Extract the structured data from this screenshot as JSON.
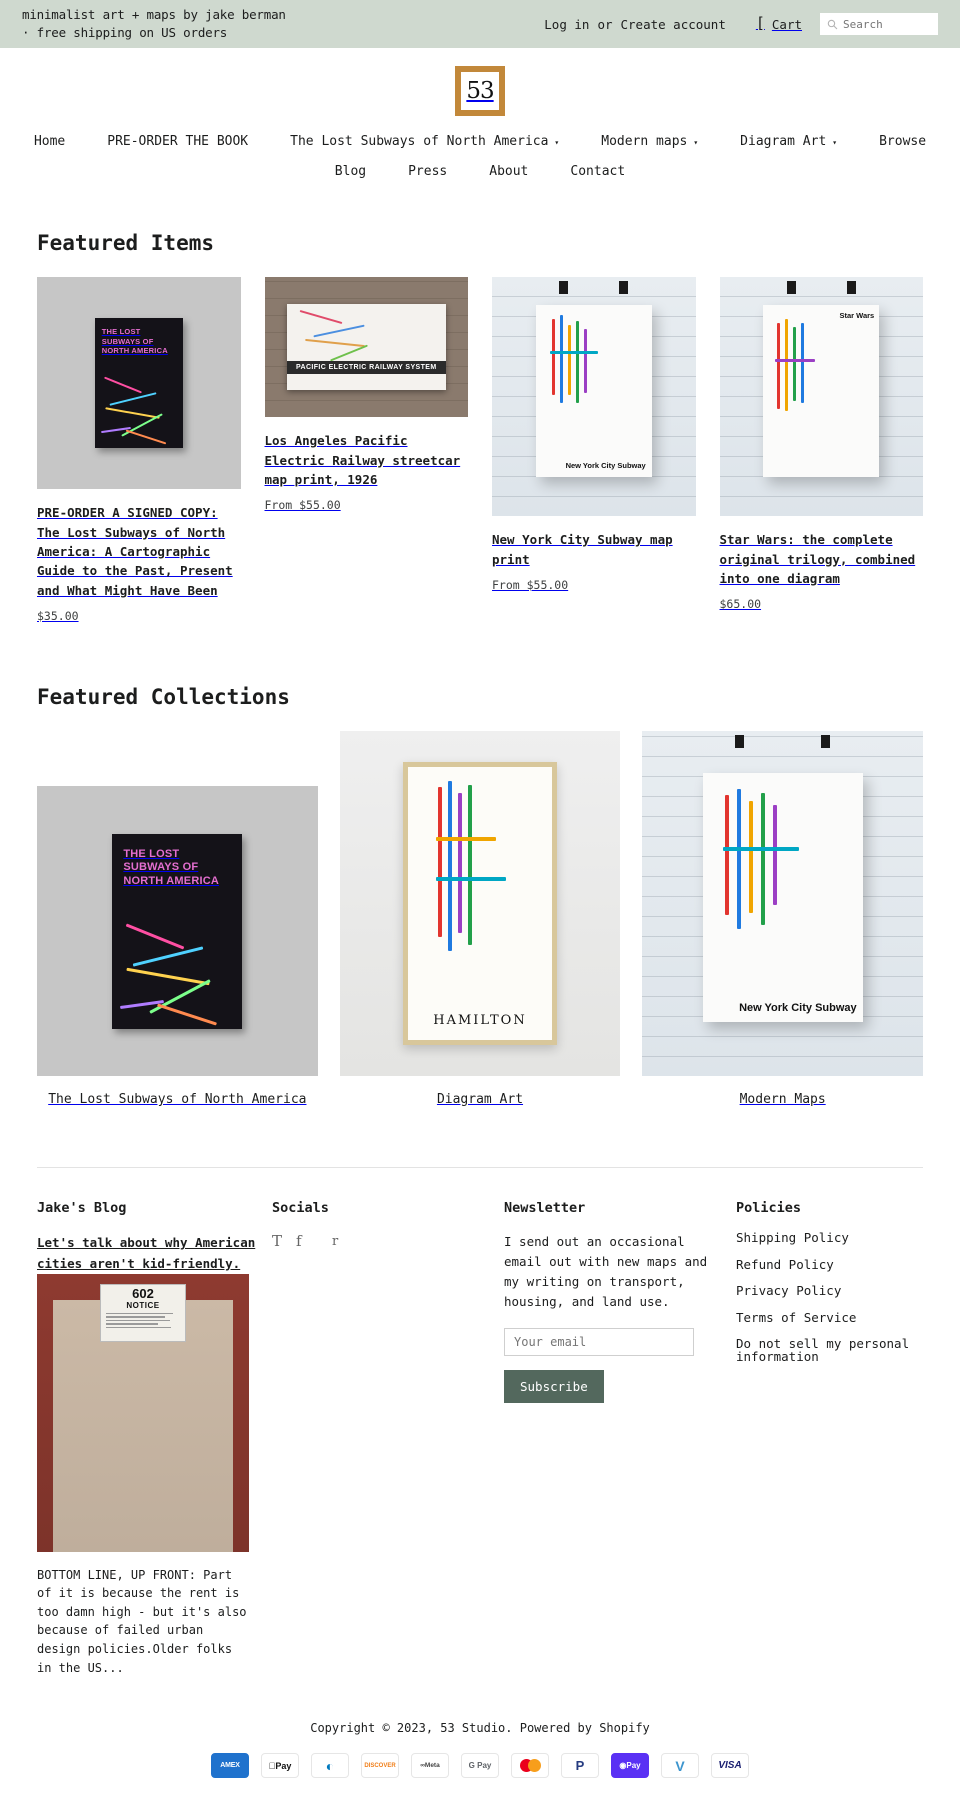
{
  "topbar": {
    "message": "minimalist art + maps by jake berman · free shipping on US orders",
    "login_label": "Log in",
    "or_label": "or",
    "create_account_label": "Create account",
    "cart_icon": "cart-icon",
    "cart_label": "Cart",
    "search_placeholder": "Search",
    "search_value": "",
    "bg_color": "#cfd9cf"
  },
  "logo": {
    "text": "53",
    "frame_color": "#c2883a"
  },
  "nav": {
    "row1": [
      {
        "label": "Home",
        "caret": ""
      },
      {
        "label": "PRE-ORDER THE BOOK",
        "caret": ""
      },
      {
        "label": "The Lost Subways of North America",
        "caret": "▾"
      },
      {
        "label": "Modern maps",
        "caret": "▾"
      },
      {
        "label": "Diagram Art",
        "caret": "▾"
      },
      {
        "label": "Browse",
        "caret": ""
      }
    ],
    "row2": [
      {
        "label": "Blog",
        "caret": ""
      },
      {
        "label": "Press",
        "caret": ""
      },
      {
        "label": "About",
        "caret": ""
      },
      {
        "label": "Contact",
        "caret": ""
      }
    ]
  },
  "featured_items": {
    "heading": "Featured Items",
    "products": [
      {
        "title": "PRE-ORDER A SIGNED COPY: The Lost Subways of North America: A Cartographic Guide to the Past, Present and What Might Have Been",
        "price": "$35.00",
        "image_alt": "book cover The Lost Subways of North America on grey background",
        "book_cover_title": "THE LOST SUBWAYS OF NORTH AMERICA"
      },
      {
        "title": "Los Angeles Pacific Electric Railway streetcar map print, 1926",
        "price": "From $55.00",
        "image_alt": "Pacific Electric Railway System map framed on brick wall",
        "map_caption": "PACIFIC ELECTRIC RAILWAY SYSTEM"
      },
      {
        "title": "New York City Subway map print",
        "price": "From $55.00",
        "image_alt": "New York City Subway map poster clipped on white brick wall",
        "poster_caption": "New York City Subway"
      },
      {
        "title": "Star Wars: the complete original trilogy, combined into one diagram",
        "price": "$65.00",
        "image_alt": "Star Wars diagram poster clipped on white brick wall",
        "poster_caption": "Star Wars"
      }
    ]
  },
  "featured_collections": {
    "heading": "Featured Collections",
    "collections": [
      {
        "name": "The Lost Subways of North America",
        "image_alt": "book cover on grey background"
      },
      {
        "name": "Diagram Art",
        "image_alt": "Hamilton diagram art framed print",
        "frame_word": "HAMILTON"
      },
      {
        "name": "Modern Maps",
        "image_alt": "New York City Subway poster on brick wall",
        "poster_caption": "New York City Subway"
      }
    ]
  },
  "footer": {
    "blog": {
      "heading": "Jake's Blog",
      "post_title": "Let's talk about why American cities aren't kid-friendly.",
      "image_alt": "photo of a doorway with a 602 NOTICE sign",
      "notice_number": "602",
      "notice_word": "NOTICE",
      "excerpt": "BOTTOM LINE, UP FRONT: Part of it is because the rent is too damn high - but it's also because of failed urban design policies.Older folks in the US..."
    },
    "socials": {
      "heading": "Socials",
      "items": [
        {
          "name": "tumblr-icon",
          "glyph": "T"
        },
        {
          "name": "facebook-icon",
          "glyph": "f"
        },
        {
          "name": "instagram-icon",
          "glyph": "r"
        }
      ]
    },
    "newsletter": {
      "heading": "Newsletter",
      "description": "I send out an occasional email out with new maps and my writing on transport, housing, and land use.",
      "input_placeholder": "Your email",
      "input_value": "",
      "button_label": "Subscribe",
      "button_color": "#53685d"
    },
    "policies": {
      "heading": "Policies",
      "links": [
        "Shipping Policy",
        "Refund Policy",
        "Privacy Policy",
        "Terms of Service",
        "Do not sell my personal information"
      ]
    }
  },
  "bottom": {
    "copyright": "Copyright © 2023, 53 Studio. Powered by Shopify",
    "payment_methods": [
      {
        "name": "amex",
        "label": "AMEX"
      },
      {
        "name": "apple-pay",
        "label": "Pay"
      },
      {
        "name": "diners-club",
        "label": ""
      },
      {
        "name": "discover",
        "label": "DISCOVER"
      },
      {
        "name": "meta-pay",
        "label": "Meta"
      },
      {
        "name": "google-pay",
        "label": "Pay"
      },
      {
        "name": "mastercard",
        "label": ""
      },
      {
        "name": "paypal",
        "label": ""
      },
      {
        "name": "shop-pay",
        "label": "Pay"
      },
      {
        "name": "venmo",
        "label": ""
      },
      {
        "name": "visa",
        "label": "VISA"
      }
    ]
  }
}
